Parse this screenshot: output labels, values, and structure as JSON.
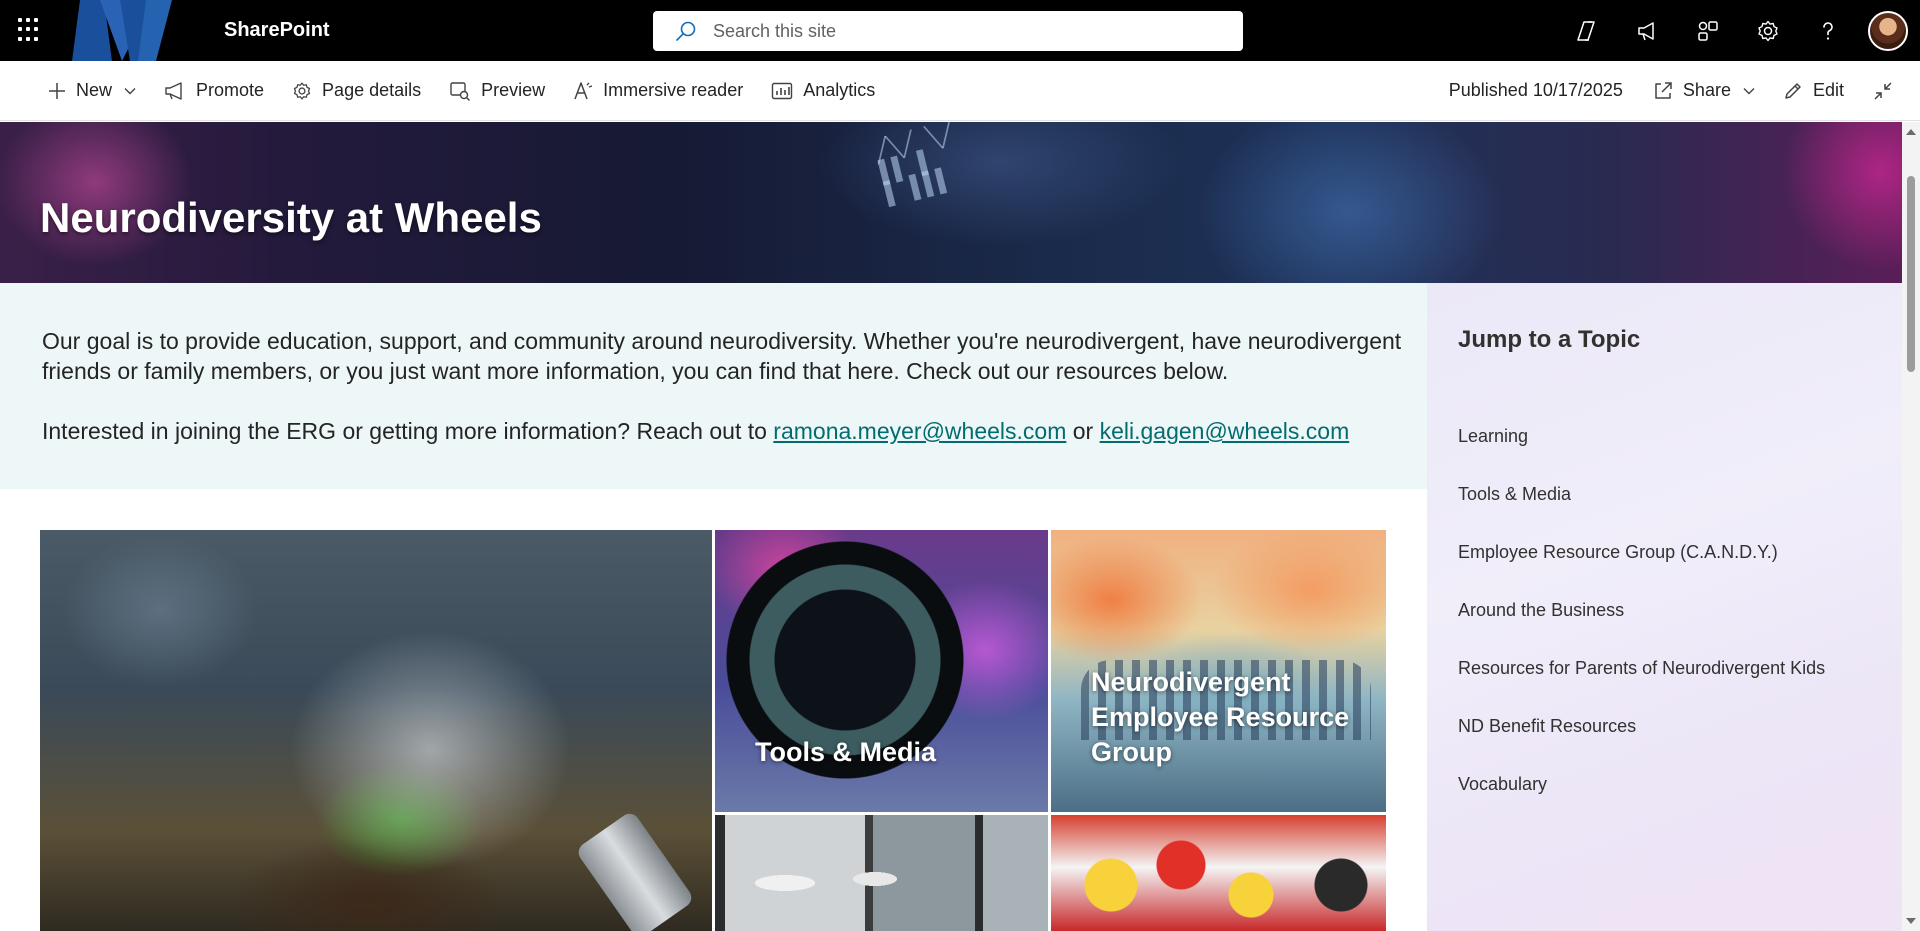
{
  "suite_bar": {
    "app_name": "SharePoint",
    "search_placeholder": "Search this site"
  },
  "command_bar": {
    "new_label": "New",
    "promote_label": "Promote",
    "page_details_label": "Page details",
    "preview_label": "Preview",
    "immersive_reader_label": "Immersive reader",
    "analytics_label": "Analytics",
    "published_text": "Published 10/17/2025",
    "share_label": "Share",
    "edit_label": "Edit"
  },
  "hero": {
    "title": "Neurodiversity at Wheels"
  },
  "intro": {
    "paragraph1": "Our goal is to provide education, support, and community around neurodiversity. Whether you're neurodivergent, have neurodivergent friends or family members, or you just want more information, you can find that here. Check out our resources below.",
    "paragraph2_prefix": "Interested in joining the ERG or getting more information? Reach out to ",
    "email1": "ramona.meyer@wheels.com",
    "or_text": " or ",
    "email2": "keli.gagen@wheels.com"
  },
  "tiles": {
    "tools_label": "Tools & Media",
    "erg_label": "Neurodivergent Employee Resource Group"
  },
  "topics": {
    "heading": "Jump to a Topic",
    "items": [
      {
        "label": "Learning"
      },
      {
        "label": "Tools & Media"
      },
      {
        "label": "Employee Resource Group (C.A.N.D.Y.)"
      },
      {
        "label": "Around the Business"
      },
      {
        "label": "Resources for Parents of Neurodivergent Kids"
      },
      {
        "label": "ND Benefit Resources"
      },
      {
        "label": "Vocabulary"
      }
    ]
  },
  "colors": {
    "suite_bar": "#000000",
    "link": "#036c70",
    "intro_background": "#eef7f8",
    "logo_blue": "#1a4f9c"
  }
}
